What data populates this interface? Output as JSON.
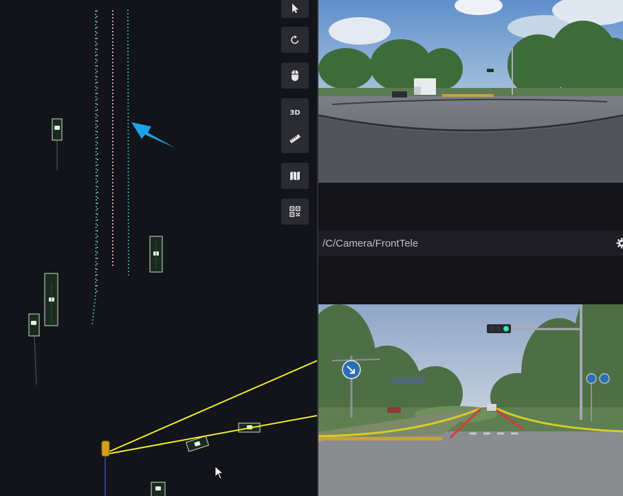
{
  "toolbar": {
    "buttons": [
      {
        "name": "select",
        "icon": "cursor-icon"
      },
      {
        "name": "reset-view",
        "icon": "rotate-icon"
      },
      {
        "name": "mouse-mode",
        "icon": "mouse-icon"
      },
      {
        "name": "view-3d",
        "icon": "3d-icon",
        "label": "3D"
      },
      {
        "name": "measure",
        "icon": "ruler-icon"
      },
      {
        "name": "map",
        "icon": "map-icon"
      },
      {
        "name": "qr",
        "icon": "qr-icon"
      }
    ]
  },
  "camera_panel": {
    "title": "/C/Camera/FrontTele",
    "settings_icon": "gear-icon"
  },
  "colors": {
    "background": "#13131a",
    "lane_teal": "#1fae8a",
    "lane_pink": "#d9a6b8",
    "obstacle_box": "#cfe6c6",
    "sensor_line": "#f2ec2a",
    "ego_vehicle": "#d4a017",
    "arrow": "#1aa3e8"
  }
}
